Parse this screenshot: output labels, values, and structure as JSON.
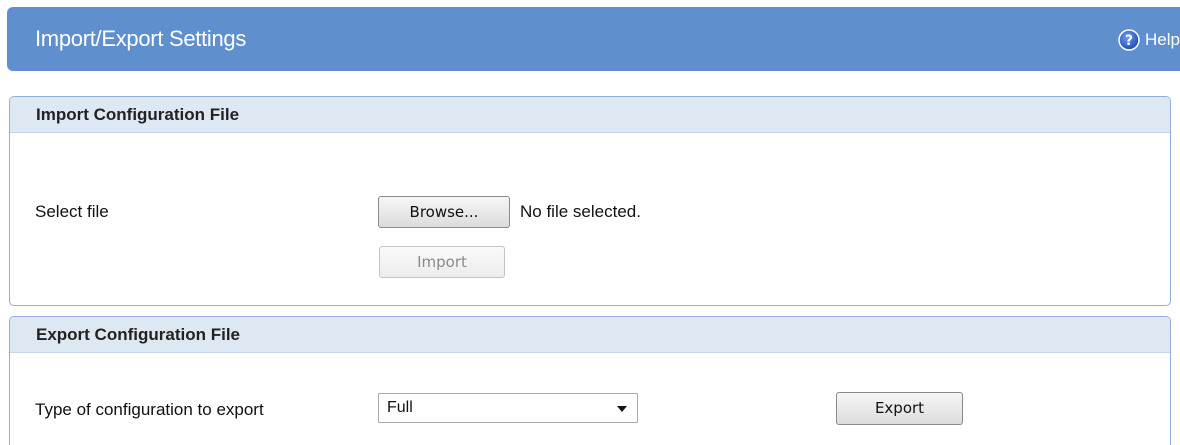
{
  "header": {
    "title": "Import/Export Settings",
    "help_label": "Help",
    "help_icon": "question-circle-icon"
  },
  "import_panel": {
    "title": "Import Configuration File",
    "select_file_label": "Select file",
    "browse_label": "Browse...",
    "file_status": "No file selected.",
    "import_label": "Import",
    "import_enabled": false
  },
  "export_panel": {
    "title": "Export Configuration File",
    "type_label": "Type of configuration to export",
    "type_selected": "Full",
    "export_label": "Export"
  },
  "colors": {
    "header_bg": "#5f8fcc",
    "panel_title_bg": "#dde8f3",
    "panel_border": "#8fb0d8",
    "help_icon_bg": "#2f62c8"
  }
}
